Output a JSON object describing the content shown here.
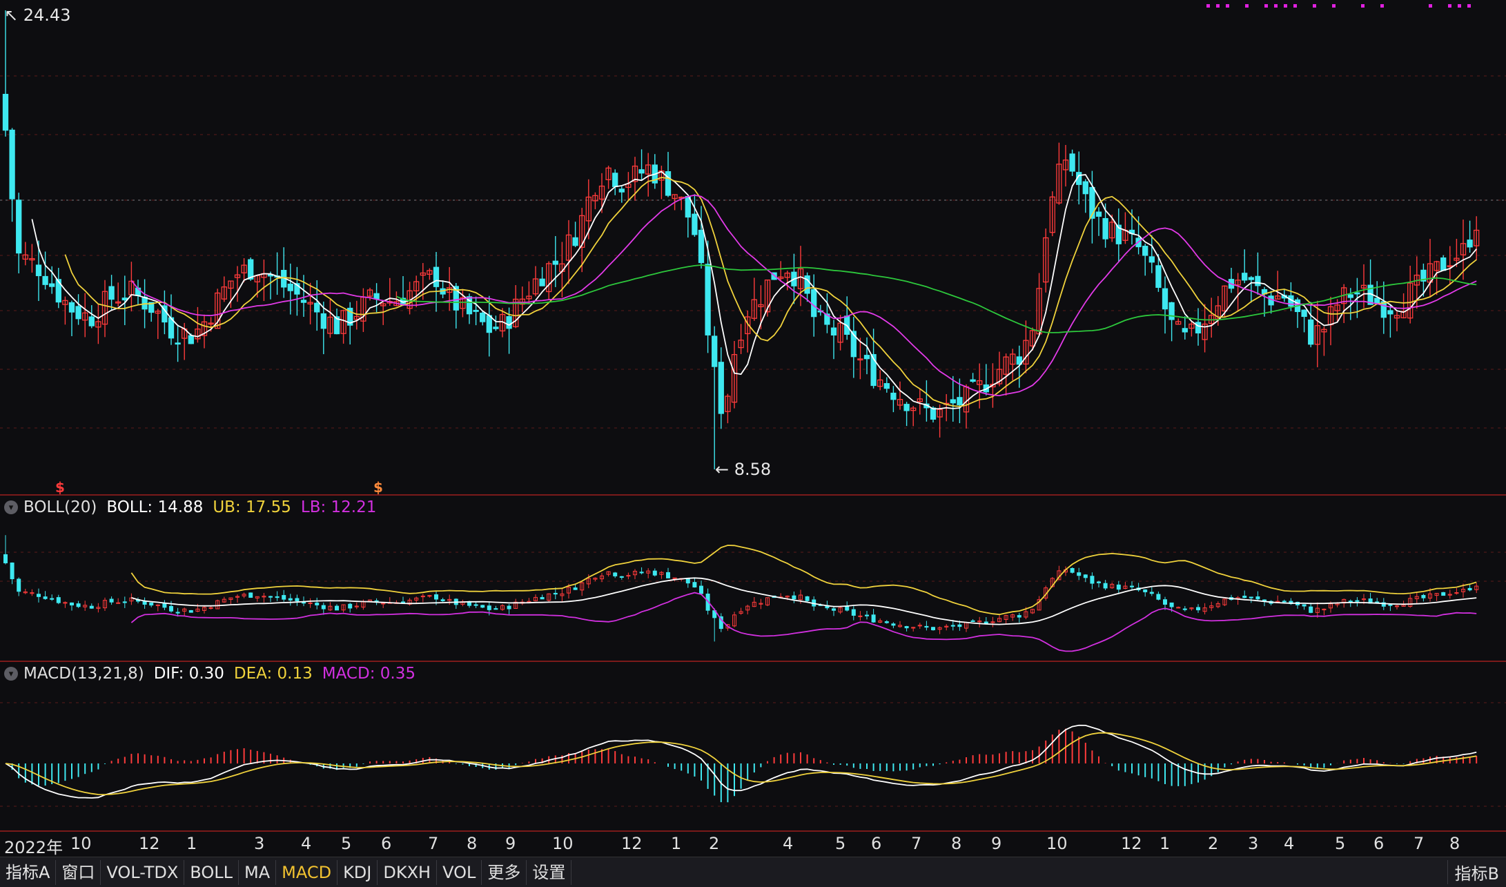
{
  "colors": {
    "up": "#ff3b3b",
    "down": "#3ee8f0",
    "ma5": "#ffffff",
    "ma10": "#f0d23c",
    "ma20": "#e23ae8",
    "ma60": "#2dc83c",
    "boll_mid": "#ffffff",
    "boll_ub": "#f0d23c",
    "boll_lb": "#d230e0",
    "dif": "#ffffff",
    "dea": "#f0d23c",
    "grid": "#5a1a1a"
  },
  "price_chart": {
    "high_label": "24.43",
    "low_label": "8.58",
    "signal_glyph": "$"
  },
  "boll": {
    "name": "BOLL(20)",
    "value_text": "BOLL: 14.88",
    "ub_text": "UB: 17.55",
    "lb_text": "LB: 12.21"
  },
  "macd": {
    "name": "MACD(13,21,8)",
    "dif_text": "DIF: 0.30",
    "dea_text": "DEA: 0.13",
    "macd_text": "MACD: 0.35"
  },
  "x_axis": {
    "labels": [
      {
        "text": "2022年"
      },
      {
        "text": "10"
      },
      {
        "text": "12"
      },
      {
        "text": "1"
      },
      {
        "text": "3"
      },
      {
        "text": "4"
      },
      {
        "text": "5"
      },
      {
        "text": "6"
      },
      {
        "text": "7"
      },
      {
        "text": "8"
      },
      {
        "text": "9"
      },
      {
        "text": "10"
      },
      {
        "text": "12"
      },
      {
        "text": "1"
      },
      {
        "text": "2"
      },
      {
        "text": "4"
      },
      {
        "text": "5"
      },
      {
        "text": "6"
      },
      {
        "text": "7"
      },
      {
        "text": "8"
      },
      {
        "text": "9"
      },
      {
        "text": "10"
      },
      {
        "text": "12"
      },
      {
        "text": "1"
      },
      {
        "text": "2"
      },
      {
        "text": "3"
      },
      {
        "text": "4"
      },
      {
        "text": "5"
      },
      {
        "text": "6"
      },
      {
        "text": "7"
      },
      {
        "text": "8"
      }
    ]
  },
  "tabs": [
    {
      "label": "指标A"
    },
    {
      "label": "窗口"
    },
    {
      "label": "VOL-TDX"
    },
    {
      "label": "BOLL"
    },
    {
      "label": "MA"
    },
    {
      "label": "MACD"
    },
    {
      "label": "KDJ"
    },
    {
      "label": "DKXH"
    },
    {
      "label": "VOL"
    },
    {
      "label": "更多"
    },
    {
      "label": "设置"
    }
  ],
  "active_tab": "MACD",
  "right_tab": "指标B",
  "chart_data": {
    "type": "candlestick",
    "price_range": [
      8.58,
      24.43
    ],
    "high": 24.43,
    "low": 8.58,
    "indicators": {
      "boll": {
        "period": 20,
        "mid": 14.88,
        "ub": 17.55,
        "lb": 12.21
      },
      "macd": {
        "params": [
          13,
          21,
          8
        ],
        "dif": 0.3,
        "dea": 0.13,
        "macd": 0.35
      }
    }
  }
}
